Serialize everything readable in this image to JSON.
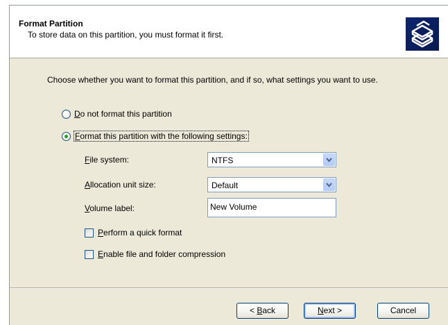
{
  "header": {
    "title": "Format Partition",
    "subtitle": "To store data on this partition, you must format it first.",
    "icon": "disk-stack-icon"
  },
  "instruction": "Choose whether you want to format this partition, and if so, what settings you want to use.",
  "options": {
    "no_format": {
      "mnemonic": "D",
      "rest": "o not format this partition",
      "selected": false
    },
    "format": {
      "mnemonic": "F",
      "rest": "ormat this partition with the following settings:",
      "selected": true
    }
  },
  "settings": {
    "file_system": {
      "mnemonic": "F",
      "rest": "ile system:",
      "value": "NTFS"
    },
    "allocation_unit": {
      "mnemonic": "A",
      "rest": "llocation unit size:",
      "value": "Default"
    },
    "volume_label": {
      "mnemonic": "V",
      "rest": "olume label:",
      "value": "New Volume"
    }
  },
  "checkboxes": {
    "quick_format": {
      "mnemonic": "P",
      "rest": "erform a quick format",
      "checked": false
    },
    "compression": {
      "mnemonic": "E",
      "rest": "nable file and folder compression",
      "checked": false
    }
  },
  "buttons": {
    "back": {
      "prefix": "< ",
      "mnemonic": "B",
      "rest": "ack"
    },
    "next": {
      "mnemonic": "N",
      "rest": "ext >"
    },
    "cancel": {
      "label": "Cancel"
    }
  },
  "colors": {
    "dialog_bg": "#ece9d8",
    "radio_dot": "#21a121",
    "input_border": "#7f9db9",
    "button_border": "#003c74"
  }
}
